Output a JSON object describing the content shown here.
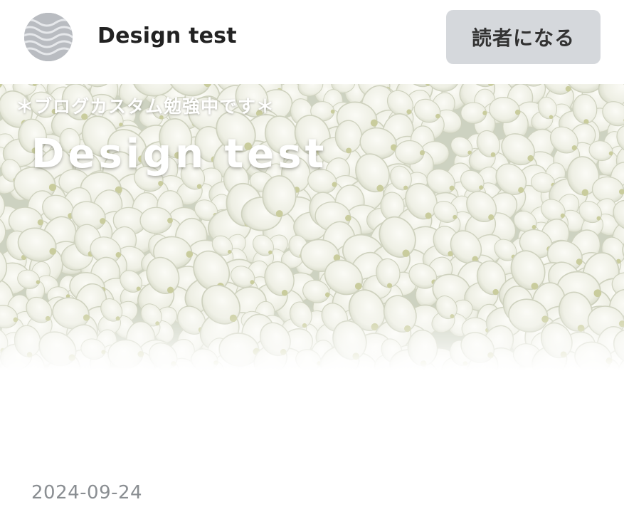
{
  "header": {
    "blog_name": "Design test",
    "subscribe_label": "読者になる",
    "avatar_icon": "wave-pattern-icon"
  },
  "hero": {
    "tagline": "＊ブログカスタム勉強中です＊",
    "title": "Design test",
    "background": "white-hydrangea-photo"
  },
  "post": {
    "date": "2024-09-24"
  },
  "colors": {
    "button_bg": "#d5d8dc",
    "title_text": "#222222",
    "date_text": "#8a8e92",
    "avatar_bg": "#b9bcc1"
  }
}
